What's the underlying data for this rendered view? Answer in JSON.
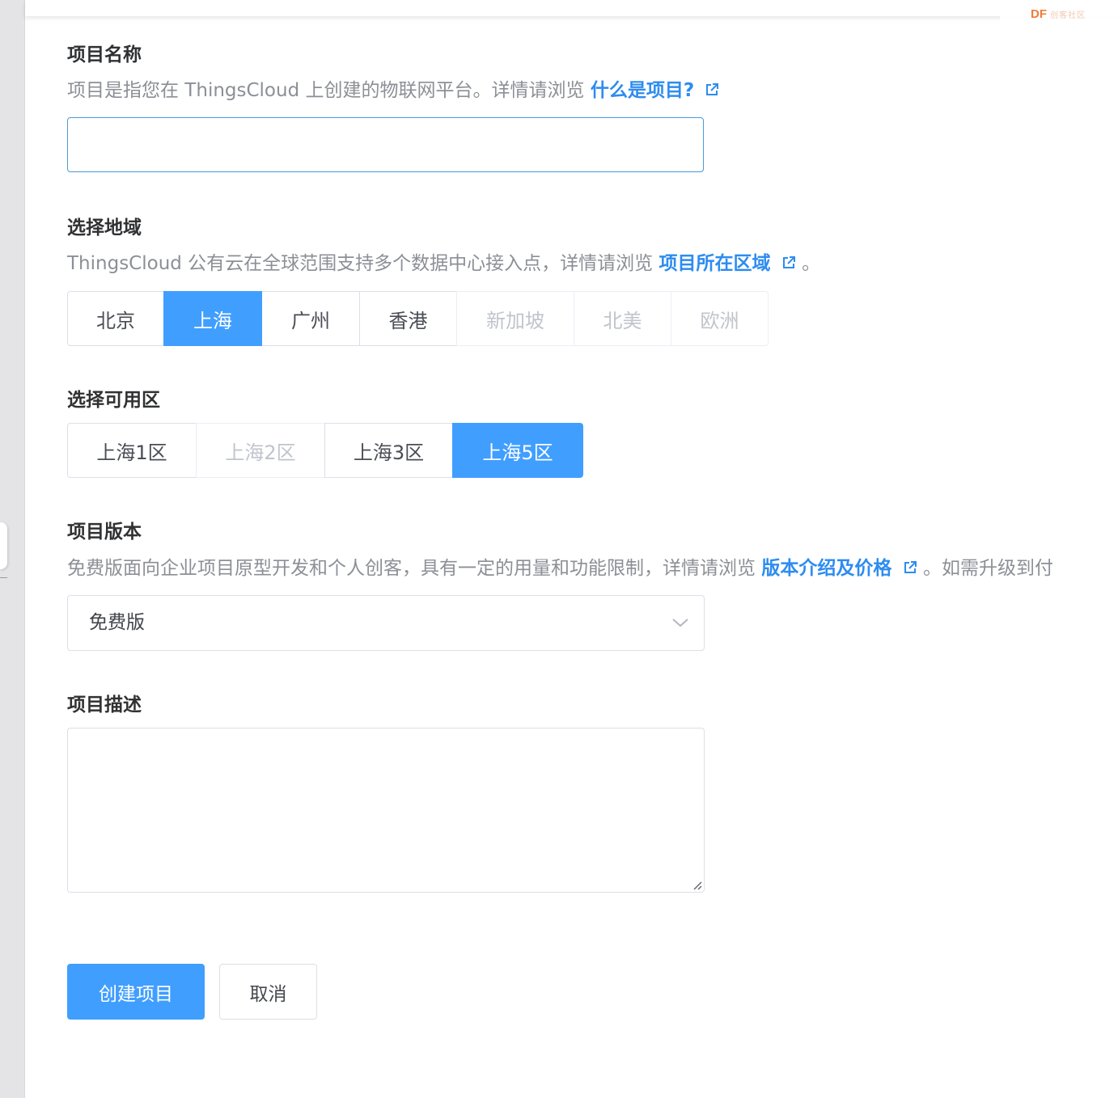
{
  "watermark": {
    "brand": "DF",
    "subtext": "创客社区"
  },
  "project_name": {
    "title": "项目名称",
    "desc_prefix": "项目是指您在 ThingsCloud 上创建的物联网平台。详情请浏览",
    "link": "什么是项目?",
    "value": "",
    "placeholder": ""
  },
  "region": {
    "title": "选择地域",
    "desc_prefix": "ThingsCloud 公有云在全球范围支持多个数据中心接入点，详情请浏览",
    "link": "项目所在区域",
    "desc_suffix": "。",
    "options": [
      "北京",
      "上海",
      "广州",
      "香港",
      "新加坡",
      "北美",
      "欧洲"
    ],
    "selected": "上海"
  },
  "zone": {
    "title": "选择可用区",
    "options": [
      "上海1区",
      "上海2区",
      "上海3区",
      "上海5区"
    ],
    "selected": "上海5区"
  },
  "edition": {
    "title": "项目版本",
    "desc_prefix": "免费版面向企业项目原型开发和个人创客，具有一定的用量和功能限制，详情请浏览",
    "link": "版本介绍及价格",
    "desc_suffix": "。如需升级到付",
    "selected": "免费版"
  },
  "description": {
    "title": "项目描述",
    "value": ""
  },
  "actions": {
    "create_label": "创建项目",
    "cancel_label": "取消"
  },
  "colors": {
    "primary": "#409eff",
    "link": "#2d8cf0",
    "focus_border": "#4a9ad8"
  }
}
